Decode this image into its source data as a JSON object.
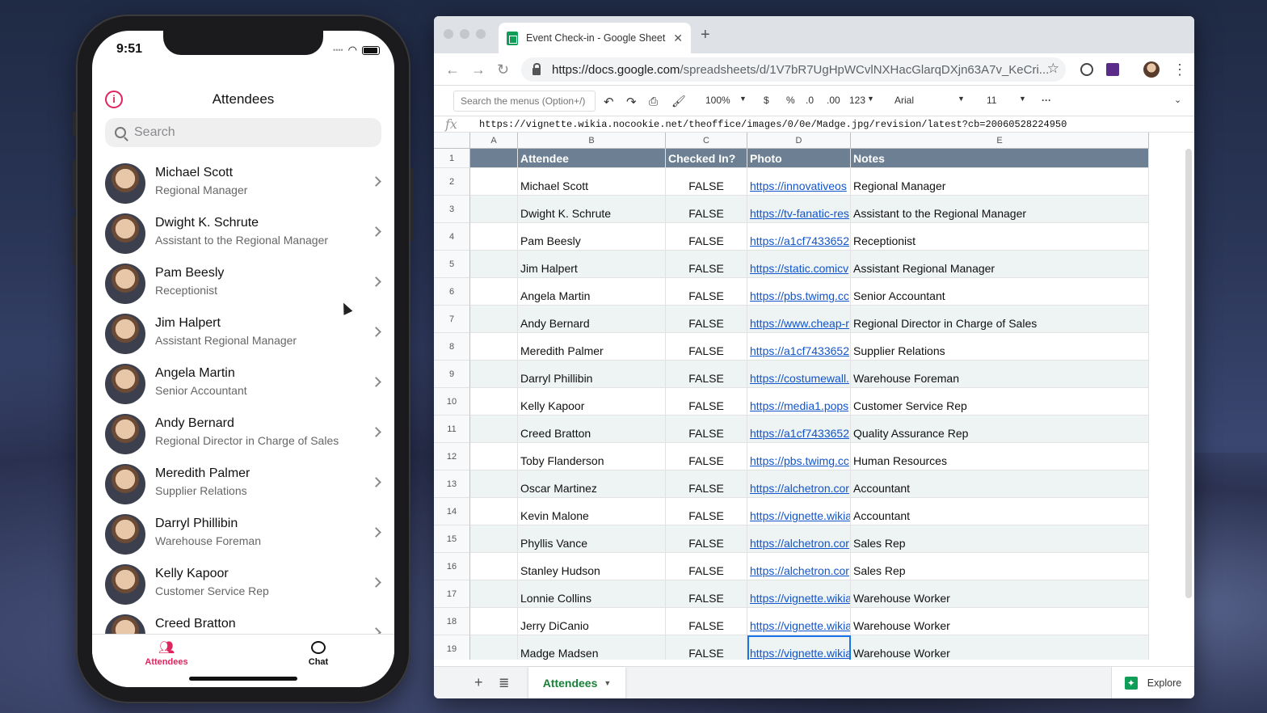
{
  "phone": {
    "time": "9:51",
    "title": "Attendees",
    "search_placeholder": "Search",
    "attendees": [
      {
        "name": "Michael Scott",
        "role": "Regional Manager"
      },
      {
        "name": "Dwight K. Schrute",
        "role": "Assistant to the Regional Manager"
      },
      {
        "name": "Pam Beesly",
        "role": "Receptionist"
      },
      {
        "name": "Jim Halpert",
        "role": "Assistant Regional Manager"
      },
      {
        "name": "Angela Martin",
        "role": "Senior Accountant"
      },
      {
        "name": "Andy Bernard",
        "role": "Regional Director in Charge of Sales"
      },
      {
        "name": "Meredith Palmer",
        "role": "Supplier Relations"
      },
      {
        "name": "Darryl Phillibin",
        "role": "Warehouse Foreman"
      },
      {
        "name": "Kelly Kapoor",
        "role": "Customer Service Rep"
      },
      {
        "name": "Creed Bratton",
        "role": ""
      }
    ],
    "tabs": [
      {
        "label": "Attendees",
        "active": true
      },
      {
        "label": "Chat",
        "active": false
      }
    ],
    "accent": "#e0245e"
  },
  "browser": {
    "tab_title": "Event Check-in - Google Sheet",
    "url_host": "https://docs.google.com",
    "url_path": "/spreadsheets/d/1V7bR7UgHpWCvlNXHacGlarqDXjn63A7v_KeCri...",
    "menu_search_placeholder": "Search the menus (Option+/)",
    "zoom": "100%",
    "currency": "$",
    "percent": "%",
    "dec_less": ".0",
    "dec_more": ".00",
    "num_format": "123",
    "font_name": "Arial",
    "font_size": "11",
    "formula_value": "https://vignette.wikia.nocookie.net/theoffice/images/0/0e/Madge.jpg/revision/latest?cb=20060528224950",
    "sheet_tab": "Attendees",
    "explore_label": "Explore"
  },
  "sheet": {
    "column_letters": [
      "A",
      "B",
      "C",
      "D",
      "E"
    ],
    "header": [
      "Attendee",
      "Checked In?",
      "Photo",
      "Notes"
    ],
    "rows": [
      {
        "n": "2",
        "name": "Michael Scott",
        "checked": "FALSE",
        "photo": "https://innovativeos",
        "notes": "Regional Manager"
      },
      {
        "n": "3",
        "name": "Dwight K. Schrute",
        "checked": "FALSE",
        "photo": "https://tv-fanatic-res",
        "notes": "Assistant to the Regional Manager"
      },
      {
        "n": "4",
        "name": "Pam Beesly",
        "checked": "FALSE",
        "photo": "https://a1cf7433652",
        "notes": "Receptionist"
      },
      {
        "n": "5",
        "name": "Jim Halpert",
        "checked": "FALSE",
        "photo": "https://static.comicv",
        "notes": "Assistant Regional Manager"
      },
      {
        "n": "6",
        "name": "Angela Martin",
        "checked": "FALSE",
        "photo": "https://pbs.twimg.cc",
        "notes": "Senior Accountant"
      },
      {
        "n": "7",
        "name": "Andy Bernard",
        "checked": "FALSE",
        "photo": "https://www.cheap-r",
        "notes": "Regional Director in Charge of Sales"
      },
      {
        "n": "8",
        "name": "Meredith Palmer",
        "checked": "FALSE",
        "photo": "https://a1cf7433652",
        "notes": "Supplier Relations"
      },
      {
        "n": "9",
        "name": "Darryl Phillibin",
        "checked": "FALSE",
        "photo": "https://costumewall.",
        "notes": "Warehouse Foreman"
      },
      {
        "n": "10",
        "name": "Kelly Kapoor",
        "checked": "FALSE",
        "photo": "https://media1.pops",
        "notes": "Customer Service Rep"
      },
      {
        "n": "11",
        "name": "Creed Bratton",
        "checked": "FALSE",
        "photo": "https://a1cf7433652",
        "notes": "Quality Assurance Rep"
      },
      {
        "n": "12",
        "name": "Toby Flanderson",
        "checked": "FALSE",
        "photo": "https://pbs.twimg.cc",
        "notes": "Human Resources"
      },
      {
        "n": "13",
        "name": "Oscar Martinez",
        "checked": "FALSE",
        "photo": "https://alchetron.cor",
        "notes": "Accountant"
      },
      {
        "n": "14",
        "name": "Kevin Malone",
        "checked": "FALSE",
        "photo": "https://vignette.wikia",
        "notes": "Accountant"
      },
      {
        "n": "15",
        "name": "Phyllis Vance",
        "checked": "FALSE",
        "photo": "https://alchetron.cor",
        "notes": "Sales Rep"
      },
      {
        "n": "16",
        "name": "Stanley Hudson",
        "checked": "FALSE",
        "photo": "https://alchetron.cor",
        "notes": "Sales Rep"
      },
      {
        "n": "17",
        "name": "Lonnie Collins",
        "checked": "FALSE",
        "photo": "https://vignette.wikia",
        "notes": "Warehouse Worker"
      },
      {
        "n": "18",
        "name": "Jerry DiCanio",
        "checked": "FALSE",
        "photo": "https://vignette.wikia",
        "notes": "Warehouse Worker"
      },
      {
        "n": "19",
        "name": "Madge Madsen",
        "checked": "FALSE",
        "photo": "https://vignette.wikia",
        "notes": "Warehouse Worker"
      }
    ],
    "header_row_number": "1",
    "header_color": "#6d8093",
    "band_color": "#eef3f4"
  }
}
